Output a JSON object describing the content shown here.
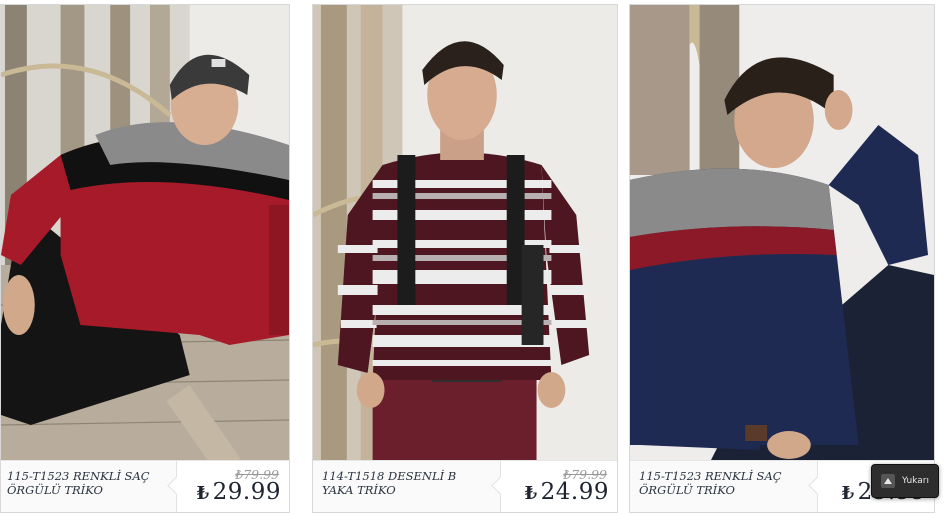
{
  "products": [
    {
      "name": "115-T1523 RENKLİ SAÇ ÖRGÜLÜ TRİKO",
      "old_price": "₺79.99",
      "currency": "₺",
      "price": "29.99",
      "image_alt": "Man wearing grey beanie and red-black-grey sweater sitting by wooden ladder"
    },
    {
      "name": "114-T1518 DESENLİ B YAKA TRİKO",
      "old_price": "₺79.99",
      "currency": "₺",
      "price": "24.99",
      "image_alt": "Man wearing burgundy patterned sweater with backpack"
    },
    {
      "name": "115-T1523 RENKLİ SAÇ ÖRGÜLÜ TRİKO",
      "old_price": "",
      "currency": "₺",
      "price": "29.99",
      "image_alt": "Man wearing navy red grey sweater leaning against wall"
    }
  ],
  "scroll_top": {
    "label": "Yukarı"
  },
  "colors": {
    "price_text": "#1e2430",
    "name_text": "#2b3440",
    "old_price_text": "#9a9a9a",
    "scroll_top_bg": "#2d2d2d"
  }
}
